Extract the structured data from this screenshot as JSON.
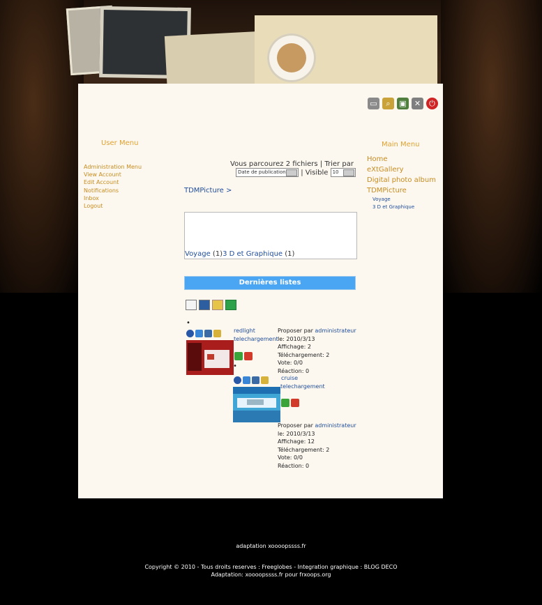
{
  "user_menu": {
    "title": "User Menu",
    "items": [
      "Administration Menu",
      "View Account",
      "Edit Account",
      "Notifications",
      "Inbox",
      "Logout"
    ]
  },
  "main_menu": {
    "title": "Main Menu",
    "items": [
      "Home",
      "eXtGallery",
      "Digital photo album",
      "TDMPicture"
    ],
    "subitems": [
      "Voyage",
      "3 D et Graphique"
    ]
  },
  "browse": {
    "text": "Vous parcourez 2 fichiers",
    "sort_label": "| Trier par",
    "sort_value": "Date de publication",
    "visible_label": "| Visible",
    "visible_value": "10"
  },
  "breadcrumb": "TDMPicture >",
  "categories": [
    {
      "name": "Voyage",
      "count": "(1)"
    },
    {
      "name": "3 D et Graphique",
      "count": "(1)"
    }
  ],
  "latest_title": "Dernières listes",
  "files": [
    {
      "name": "redlight",
      "download": "telechargement",
      "proposed_label": "Proposer par",
      "author": "administrateur",
      "date": "le:  2010/3/13",
      "views": "Affichage:  2",
      "downloads": "Téléchargement:  2",
      "vote": "Vote:  0/0",
      "reaction": "Réaction:  0"
    },
    {
      "name": "cruise",
      "download": "telechargement",
      "proposed_label": "Proposer par",
      "author": "administrateur",
      "date": "le:  2010/3/13",
      "views": "Affichage:  12",
      "downloads": "Téléchargement:  2",
      "vote": "Vote:  0/0",
      "reaction": "Réaction:  0"
    }
  ],
  "footer": {
    "line1": "adaptation xoooopssss.fr",
    "line2": "Copyright © 2010 - Tous droits reserves : Freeglobes - Integration graphique : BLOG DECO",
    "line3": "Adaptation: xoooopssss.fr pour frxoops.org"
  },
  "colors": {
    "accent": "#e0a12e",
    "link": "#1f4c9a",
    "bar": "#4aa5f3"
  },
  "icons": [
    "pda-icon",
    "search-icon",
    "image-icon",
    "tools-icon",
    "power-icon"
  ]
}
